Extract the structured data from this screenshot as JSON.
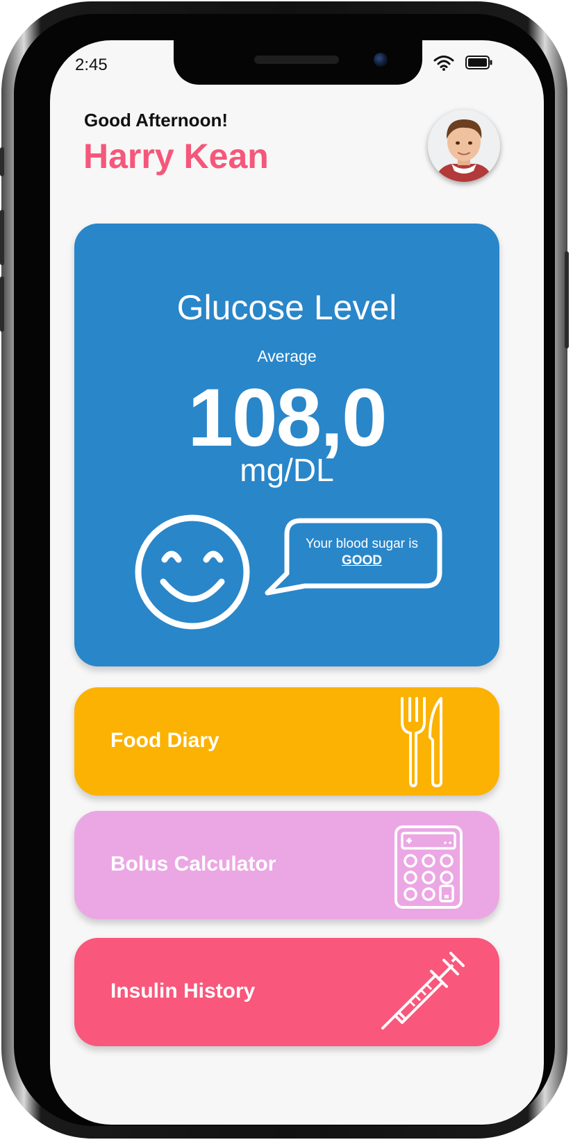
{
  "status_bar": {
    "time": "2:45",
    "icons": [
      "wifi-icon",
      "battery-icon"
    ]
  },
  "header": {
    "greeting": "Good Afternoon!",
    "user_name": "Harry Kean",
    "avatar": "avatar"
  },
  "glucose": {
    "title": "Glucose Level",
    "average_label": "Average",
    "value": "108,0",
    "unit": "mg/DL",
    "message": "Your blood sugar is",
    "status": "GOOD",
    "icon": "smiley-icon"
  },
  "menu": {
    "food": {
      "label": "Food Diary",
      "icon": "fork-knife-icon"
    },
    "bolus": {
      "label": "Bolus Calculator",
      "icon": "calculator-icon"
    },
    "insulin": {
      "label": "Insulin History",
      "icon": "syringe-icon"
    }
  },
  "colors": {
    "accent_name": "#f5577a",
    "glucose_card": "#2986c9",
    "food_card": "#fbb203",
    "bolus_card": "#eba7e3",
    "insulin_card": "#f9577b",
    "screen_bg": "#f7f7f7"
  }
}
